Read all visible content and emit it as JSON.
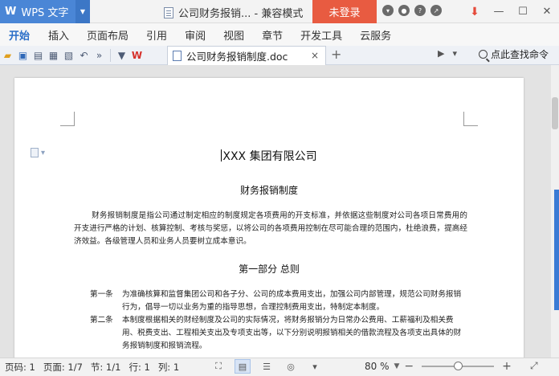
{
  "titlebar": {
    "app_logo": "W",
    "app_name": "WPS 文字",
    "doc_title": "公司财务报销... - 兼容模式",
    "login_label": "未登录"
  },
  "menubar": {
    "tabs": [
      {
        "label": "开始",
        "active": true
      },
      {
        "label": "插入"
      },
      {
        "label": "页面布局"
      },
      {
        "label": "引用"
      },
      {
        "label": "审阅"
      },
      {
        "label": "视图"
      },
      {
        "label": "章节"
      },
      {
        "label": "开发工具"
      },
      {
        "label": "云服务"
      }
    ]
  },
  "doctab": {
    "label": "公司财务报销制度.doc",
    "close": "×",
    "new_tab": "+"
  },
  "search": {
    "label": "点此查找命令"
  },
  "document": {
    "heading": "XXX 集团有限公司",
    "subtitle": "财务报销制度",
    "intro": "财务报销制度是指公司通过制定相应的制度规定各项费用的开支标准，并依据这些制度对公司各项日常费用的开支进行严格的计划、核算控制、考核与奖惩，以将公司的各项费用控制在尽可能合理的范围内，杜绝浪费，提高经济效益。各级管理人员和业务人员要树立成本意识。",
    "section_title": "第一部分  总则",
    "articles": [
      {
        "label": "第一条",
        "text": "为准确核算和监督集团公司和各子分、公司的成本费用支出，加强公司内部管理，规范公司财务报销行为，倡导一切以业务为重的指导思想，合理控制费用支出，特制定本制度。"
      },
      {
        "label": "第二条",
        "text": "本制度根据相关的财经制度及公司的实际情况，将财务报销分为日常办公费用、工薪福利及相关费用、税费支出、工程相关支出及专项支出等，以下分别说明报销相关的借款流程及各项支出具体的财务报销制度和报销流程。"
      }
    ]
  },
  "statusbar": {
    "page_code": "页码: 1",
    "page": "页面: 1/7",
    "section": "节: 1/1",
    "row": "行: 1",
    "col": "列: 1",
    "zoom": "80 %",
    "zoom_minus": "−",
    "zoom_plus": "+",
    "zoom_fraction": 0.5
  },
  "colors": {
    "app_blue": "#4a86d6",
    "login_red": "#e85b41",
    "active_tab": "#2a6ec8"
  }
}
